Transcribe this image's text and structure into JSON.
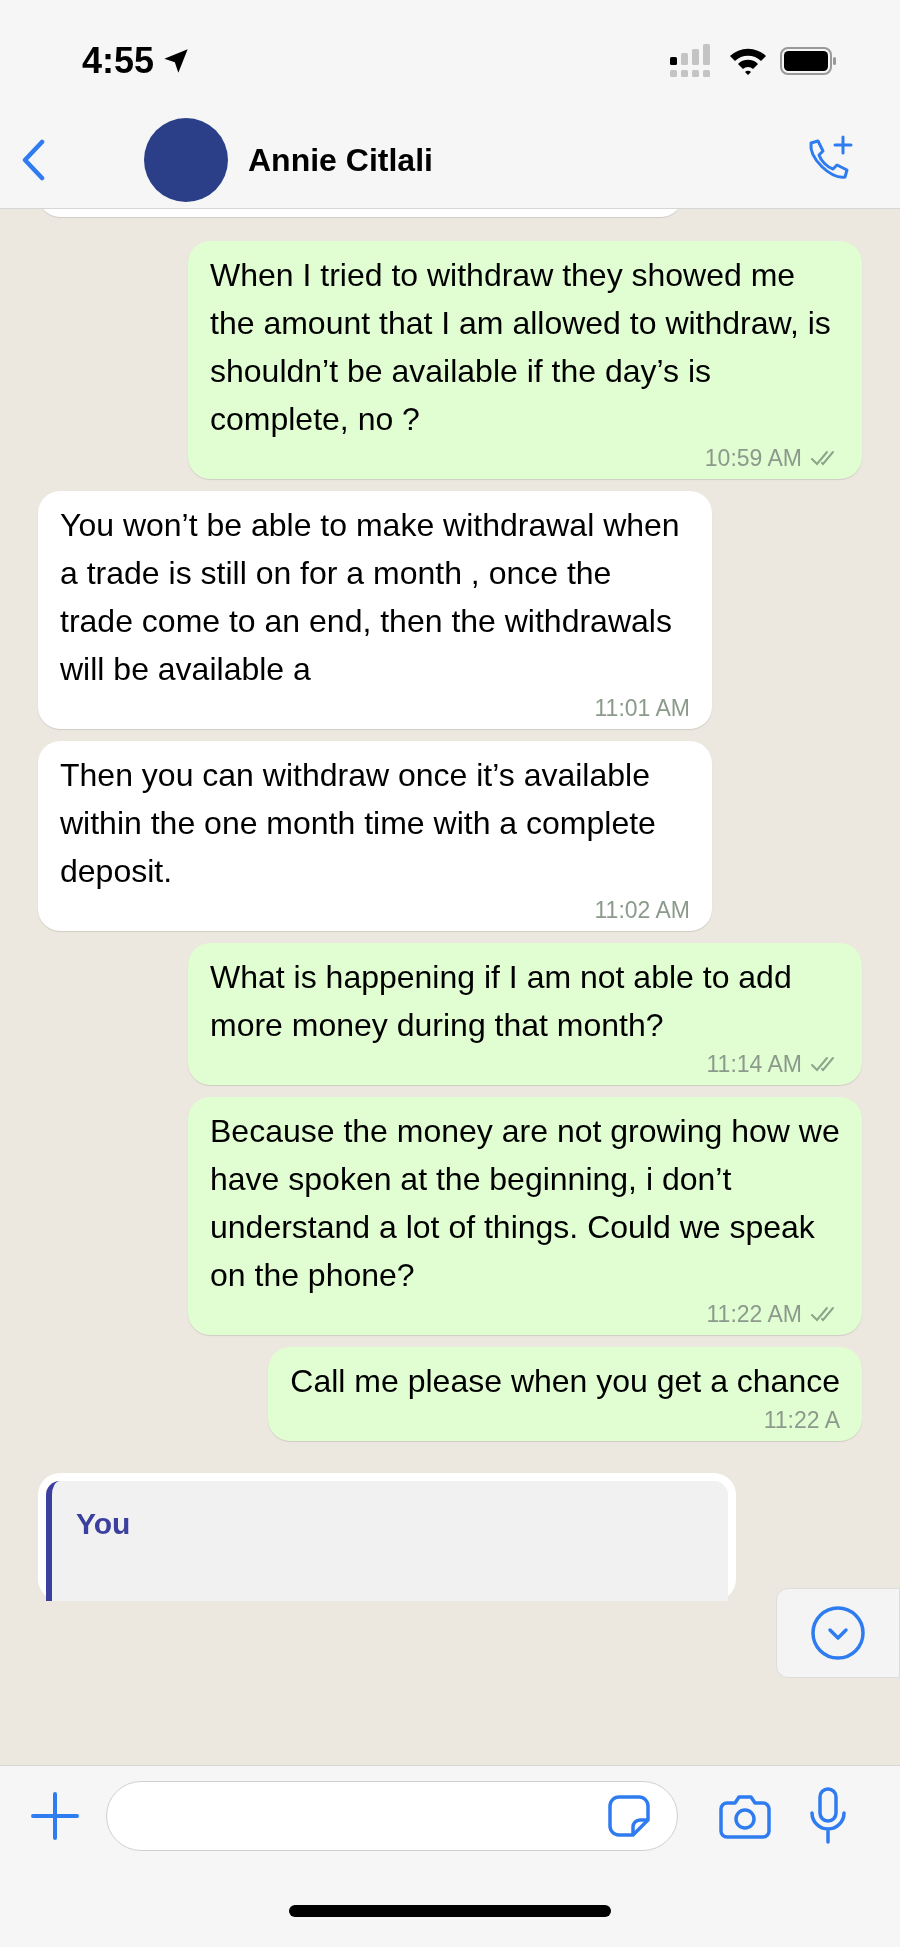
{
  "status_bar": {
    "time": "4:55"
  },
  "header": {
    "contact_name": "Annie Citlali"
  },
  "messages": [
    {
      "kind": "out",
      "text": "When I tried to withdraw they showed me the amount that I am allowed to withdraw, is shouldn’t be available if the day’s is complete, no ?",
      "time": "10:59 AM",
      "read": true
    },
    {
      "kind": "in",
      "text": "You won’t be able to make withdrawal when a trade is still on for a month , once the trade come to an end, then the withdrawals will be available a",
      "time": "11:01 AM"
    },
    {
      "kind": "in",
      "text": "Then you can withdraw once it’s available within the one month time with a complete deposit.",
      "time": "11:02 AM"
    },
    {
      "kind": "out",
      "text": "What is happening if I am not able to add more money during that month?",
      "time": "11:14 AM",
      "read": true
    },
    {
      "kind": "out",
      "text": "Because the money are not growing how we have spoken at the beginning, i don’t understand a lot of things. Could we speak on the phone?",
      "time": "11:22 AM",
      "read": true
    },
    {
      "kind": "out",
      "text": "Call me please when you get a chance",
      "time": "11:22 A"
    }
  ],
  "reply_preview": {
    "sender": "You"
  }
}
